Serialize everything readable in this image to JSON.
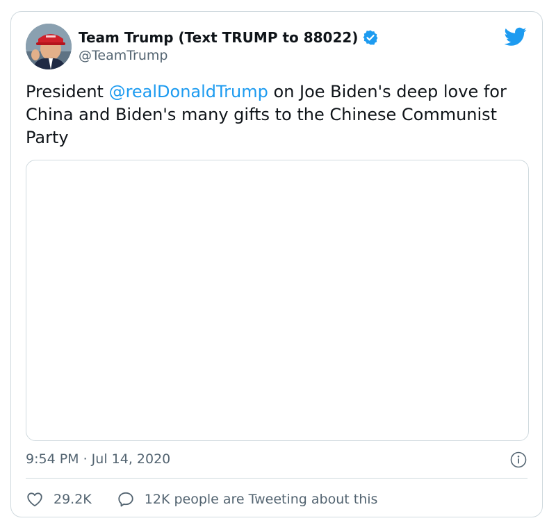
{
  "tweet": {
    "author": {
      "display_name": "Team Trump (Text TRUMP to 88022)",
      "handle": "@TeamTrump"
    },
    "text_before": "President ",
    "mention": "@realDonaldTrump",
    "text_after": " on Joe Biden's deep love for China and Biden's many gifts to the Chinese Communist Party",
    "timestamp": "9:54 PM · Jul 14, 2020",
    "likes": "29.2K",
    "conversation_label": "12K people are Tweeting about this"
  },
  "colors": {
    "link": "#1d9bf0",
    "secondary_text": "#536471",
    "border": "#cfd9de"
  },
  "icons": [
    "verified-badge-icon",
    "twitter-bird-icon",
    "info-icon",
    "heart-icon",
    "reply-bubble-icon"
  ]
}
